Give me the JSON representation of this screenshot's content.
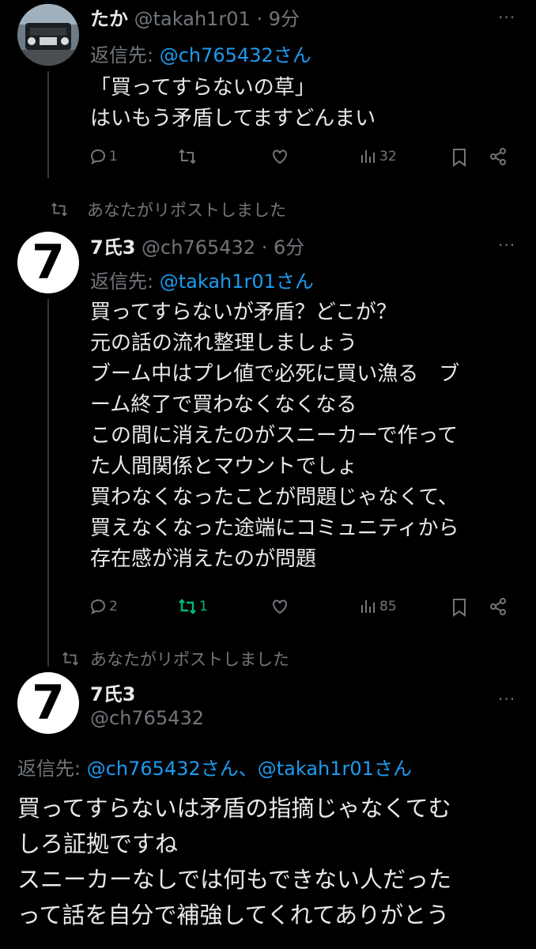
{
  "tweet1": {
    "name": "たか",
    "handle": "@takah1r01",
    "time": "· 9分",
    "reply_prefix": "返信先:",
    "reply_to": "@ch765432さん",
    "lines": [
      "「買ってすらないの草」",
      "はいもう矛盾してますどんまい"
    ],
    "stats": {
      "replies": "1",
      "retweets": "",
      "likes": "",
      "views": "32"
    }
  },
  "repost_label_1": "あなたがリポストしました",
  "tweet2": {
    "name": "7氏3",
    "handle": "@ch765432",
    "time": "· 6分",
    "reply_prefix": "返信先:",
    "reply_to": "@takah1r01さん",
    "lines": [
      "買ってすらないが矛盾？どこが？",
      "元の話の流れ整理しましょう",
      "ブーム中はプレ値で必死に買い漁る　ブ",
      "ーム終了で買わなくなくなる",
      "この間に消えたのがスニーカーで作って",
      "た人間関係とマウントでしょ",
      "買わなくなったことが問題じゃなくて、",
      "買えなくなった途端にコミュニティから",
      "存在感が消えたのが問題"
    ],
    "stats": {
      "replies": "2",
      "retweets": "1",
      "likes": "",
      "views": "85"
    }
  },
  "repost_label_2": "あなたがリポストしました",
  "tweet3": {
    "name": "7氏3",
    "handle": "@ch765432",
    "reply_prefix": "返信先:",
    "reply_to": "@ch765432さん、@takah1r01さん",
    "lines": [
      "買ってすらないは矛盾の指摘じゃなくてむ",
      "しろ証拠ですね",
      "スニーカーなしでは何もできない人だった",
      "って話を自分で補強してくれてありがとう"
    ]
  },
  "avatar_glyph": "7",
  "colors": {
    "link": "#1d9bf0",
    "muted": "#71767b",
    "retweet_green": "#00ba7c",
    "background": "#000000"
  }
}
